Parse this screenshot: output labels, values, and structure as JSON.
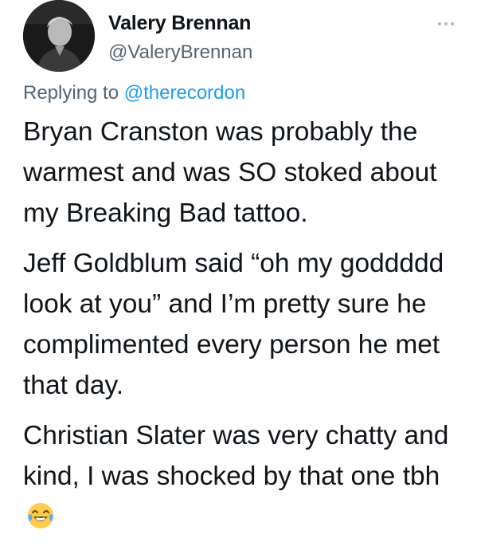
{
  "author": {
    "name": "Valery Brennan",
    "handle": "@ValeryBrennan"
  },
  "reply": {
    "prefix": "Replying to ",
    "mention": "@therecordon"
  },
  "tweet": {
    "paragraphs": [
      "Bryan Cranston was probably the warmest and was SO stoked about my Breaking Bad tattoo.",
      "Jeff Goldblum said “oh my goddddd look at you” and I’m pretty sure he complimented every person he met that day.",
      "Christian Slater was very chatty and kind, I was shocked by that one tbh"
    ],
    "trailing_emoji": "face-with-tears-of-joy-emoji"
  },
  "colors": {
    "text": "#0f1419",
    "secondary": "#536471",
    "link": "#1d9bf0"
  }
}
